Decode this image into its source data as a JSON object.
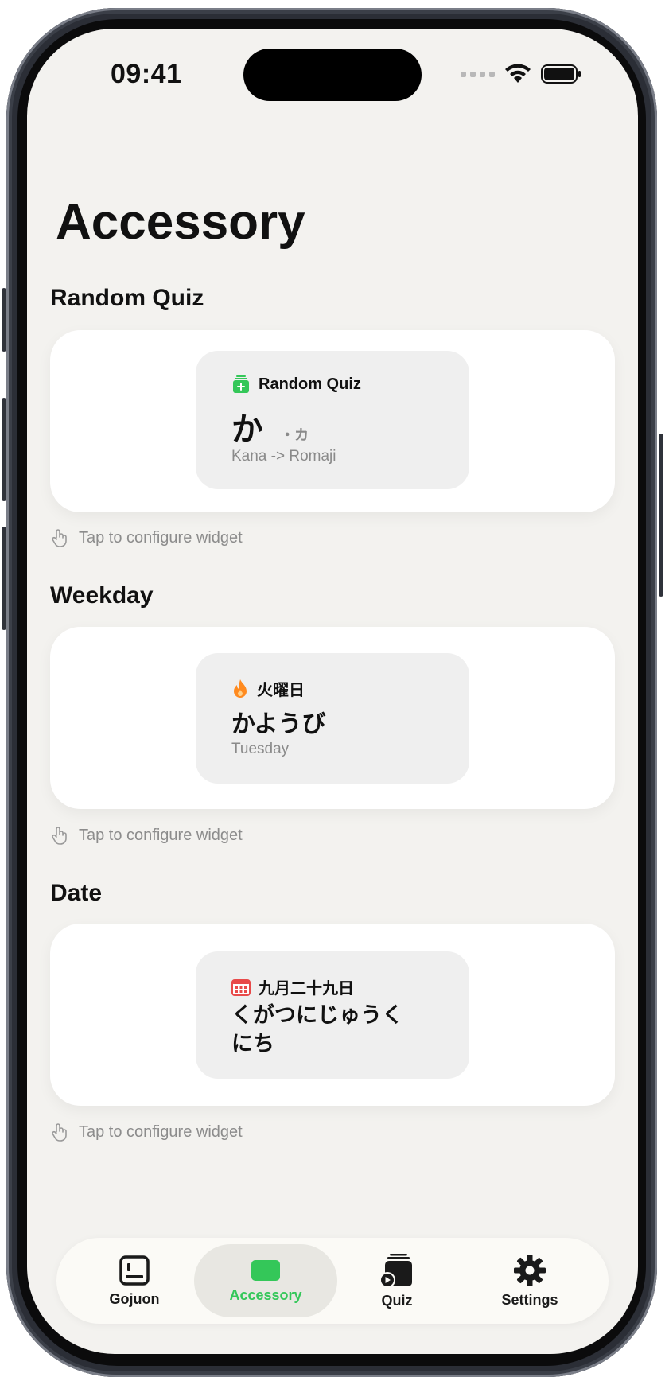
{
  "status": {
    "time": "09:41"
  },
  "page": {
    "title": "Accessory"
  },
  "sections": [
    {
      "title": "Random Quiz",
      "widget": {
        "header": "Random Quiz",
        "main": "か",
        "main_secondary": "・カ",
        "sub": "Kana -> Romaji",
        "icon": "quiz-stack-icon"
      },
      "hint": "Tap to configure widget"
    },
    {
      "title": "Weekday",
      "widget": {
        "header": "火曜日",
        "main": "かようび",
        "sub": "Tuesday",
        "icon": "flame-icon"
      },
      "hint": "Tap to configure widget"
    },
    {
      "title": "Date",
      "widget": {
        "header": "九月二十九日",
        "main_line1": "くがつにじゅうく",
        "main_line2": "にち",
        "icon": "calendar-icon"
      },
      "hint": "Tap to configure widget"
    }
  ],
  "tabs": [
    {
      "label": "Gojuon",
      "icon": "gojuon-icon",
      "active": false
    },
    {
      "label": "Accessory",
      "icon": "accessory-icon",
      "active": true
    },
    {
      "label": "Quiz",
      "icon": "quiz-cards-icon",
      "active": false
    },
    {
      "label": "Settings",
      "icon": "gear-icon",
      "active": false
    }
  ],
  "colors": {
    "accent": "#34c759",
    "background": "#f3f2ef",
    "flame": "#ff8a1f",
    "calendar": "#e84a4a"
  }
}
